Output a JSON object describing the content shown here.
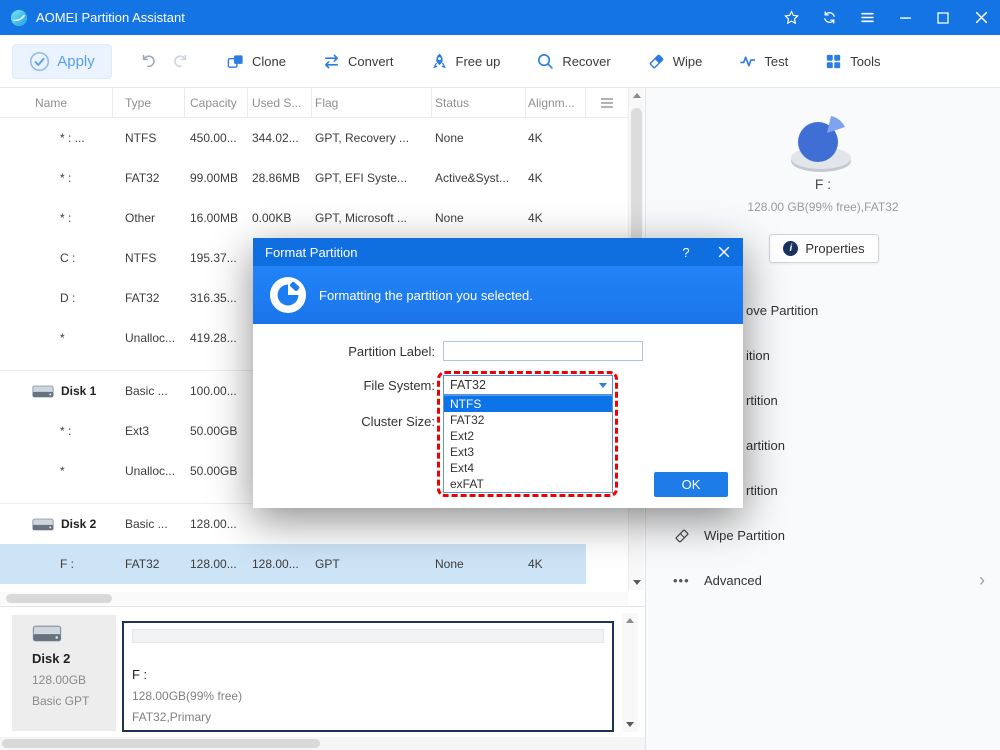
{
  "titlebar": {
    "title": "AOMEI Partition Assistant"
  },
  "toolbar": {
    "apply_label": "Apply",
    "buttons": [
      {
        "label": "Clone",
        "icon": "clone-icon"
      },
      {
        "label": "Convert",
        "icon": "convert-icon"
      },
      {
        "label": "Free up",
        "icon": "freeup-icon"
      },
      {
        "label": "Recover",
        "icon": "recover-icon"
      },
      {
        "label": "Wipe",
        "icon": "wipe-icon"
      },
      {
        "label": "Test",
        "icon": "test-icon"
      },
      {
        "label": "Tools",
        "icon": "tools-icon"
      }
    ]
  },
  "table": {
    "columns": [
      "Name",
      "Type",
      "Capacity",
      "Used S...",
      "Flag",
      "Status",
      "Alignm..."
    ],
    "rows": [
      {
        "name": "* : ...",
        "type": "NTFS",
        "capacity": "450.00...",
        "used": "344.02...",
        "flag": "GPT, Recovery ...",
        "status": "None",
        "align": "4K",
        "kind": "partition",
        "selected": false
      },
      {
        "name": "* :",
        "type": "FAT32",
        "capacity": "99.00MB",
        "used": "28.86MB",
        "flag": "GPT, EFI Syste...",
        "status": "Active&Syst...",
        "align": "4K",
        "kind": "partition",
        "selected": false
      },
      {
        "name": "* :",
        "type": "Other",
        "capacity": "16.00MB",
        "used": "0.00KB",
        "flag": "GPT, Microsoft ...",
        "status": "None",
        "align": "4K",
        "kind": "partition",
        "selected": false
      },
      {
        "name": "C :",
        "type": "NTFS",
        "capacity": "195.37...",
        "used": "",
        "flag": "",
        "status": "",
        "align": "",
        "kind": "partition",
        "selected": false
      },
      {
        "name": "D :",
        "type": "FAT32",
        "capacity": "316.35...",
        "used": "",
        "flag": "",
        "status": "",
        "align": "",
        "kind": "partition",
        "selected": false
      },
      {
        "name": "*",
        "type": "Unalloc...",
        "capacity": "419.28...",
        "used": "",
        "flag": "",
        "status": "",
        "align": "",
        "kind": "partition",
        "selected": false
      },
      {
        "name": "Disk 1",
        "type": "Basic ...",
        "capacity": "100.00...",
        "used": "",
        "flag": "",
        "status": "",
        "align": "",
        "kind": "disk",
        "selected": false
      },
      {
        "name": "* :",
        "type": "Ext3",
        "capacity": "50.00GB",
        "used": "",
        "flag": "",
        "status": "",
        "align": "",
        "kind": "partition",
        "selected": false
      },
      {
        "name": "*",
        "type": "Unalloc...",
        "capacity": "50.00GB",
        "used": "",
        "flag": "",
        "status": "",
        "align": "",
        "kind": "partition",
        "selected": false
      },
      {
        "name": "Disk 2",
        "type": "Basic ...",
        "capacity": "128.00...",
        "used": "",
        "flag": "",
        "status": "",
        "align": "",
        "kind": "disk",
        "selected": false
      },
      {
        "name": "F :",
        "type": "FAT32",
        "capacity": "128.00...",
        "used": "128.00...",
        "flag": "GPT",
        "status": "None",
        "align": "4K",
        "kind": "partition",
        "selected": true
      }
    ]
  },
  "sidebar": {
    "partition_name": "F :",
    "partition_info": "128.00 GB(99% free),FAT32",
    "properties_label": "Properties",
    "menu_items": [
      {
        "label": "ove Partition",
        "fragment": true
      },
      {
        "label": "ition",
        "fragment": true
      },
      {
        "label": "rtition",
        "fragment": true
      },
      {
        "label": "artition",
        "fragment": true
      },
      {
        "label": "rtition",
        "fragment": true
      },
      {
        "label": "Wipe Partition",
        "icon": "wipe-partition-icon"
      },
      {
        "label": "Advanced",
        "icon": "advanced-dots-icon",
        "chevron": true
      }
    ]
  },
  "dialog": {
    "title": "Format Partition",
    "help_label": "?",
    "subtitle": "Formatting the partition you selected.",
    "partition_label_label": "Partition Label:",
    "partition_label_value": "",
    "file_system_label": "File System:",
    "file_system_value": "FAT32",
    "cluster_size_label": "Cluster Size:",
    "file_system_options": [
      "NTFS",
      "FAT32",
      "Ext2",
      "Ext3",
      "Ext4",
      "exFAT"
    ],
    "selected_option": "NTFS",
    "ok_label": "OK"
  },
  "bottom_panel": {
    "disk_name": "Disk 2",
    "disk_capacity": "128.00GB",
    "disk_type": "Basic GPT",
    "partition_name": "F :",
    "partition_info": "128.00GB(99% free)",
    "partition_fs": "FAT32,Primary"
  },
  "colors": {
    "titlebar_blue": "#1474e4",
    "dialog_header_blue": "#1d7cf2",
    "selection_blue": "#cde3f6",
    "accent_blue": "#2a7de1",
    "ok_button_blue": "#1e7ce8",
    "dropdown_selected_blue": "#0c74e8",
    "annotation_red": "#f00000"
  }
}
